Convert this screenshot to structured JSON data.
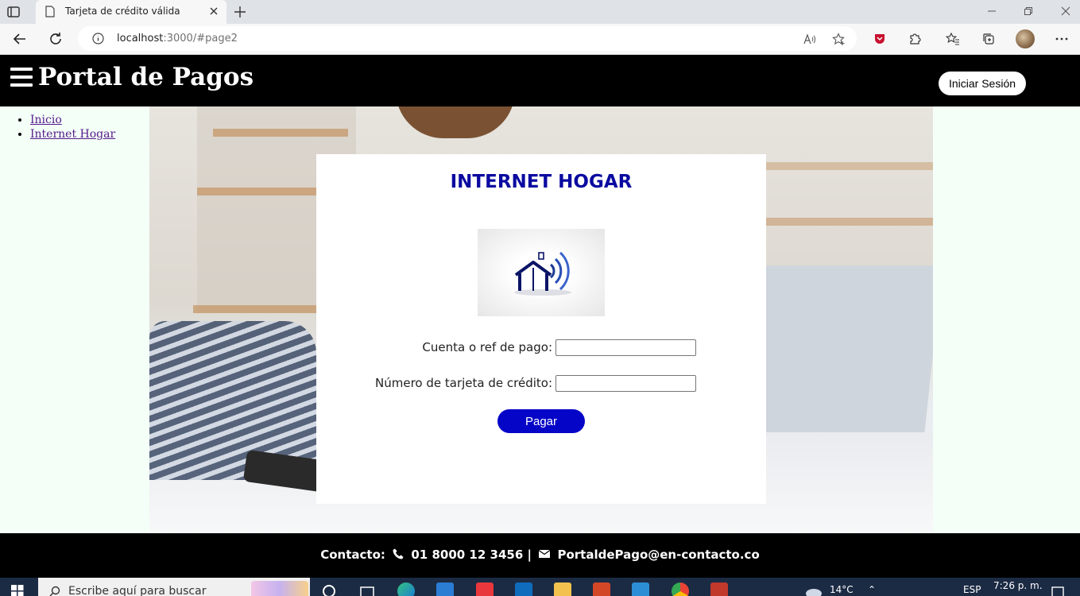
{
  "browser": {
    "tab_title": "Tarjeta de crédito válida",
    "url_host": "localhost",
    "url_rest": ":3000/#page2"
  },
  "site": {
    "brand": "Portal de Pagos",
    "login_label": "Iniciar Sesión",
    "nav": [
      {
        "label": "Inicio"
      },
      {
        "label": "Internet Hogar"
      }
    ]
  },
  "form": {
    "title": "INTERNET HOGAR",
    "account_label": "Cuenta o ref de pago:",
    "account_value": "",
    "card_label": "Número de tarjeta de crédito:",
    "card_value": "",
    "pay_label": "Pagar"
  },
  "footer": {
    "contact_prefix": "Contacto:",
    "phone": "01 8000 12 3456",
    "separator": "|",
    "email": "PortaldePago@en-contacto.co"
  },
  "taskbar": {
    "search_placeholder": "Escribe aquí para buscar",
    "weather": "14°C",
    "language": "ESP",
    "time": "7:26 p. m."
  },
  "colors": {
    "header_bg": "#000000",
    "side_bg": "#f3fff7",
    "title_color": "#0a0aa0",
    "pay_button": "#0505c8"
  }
}
